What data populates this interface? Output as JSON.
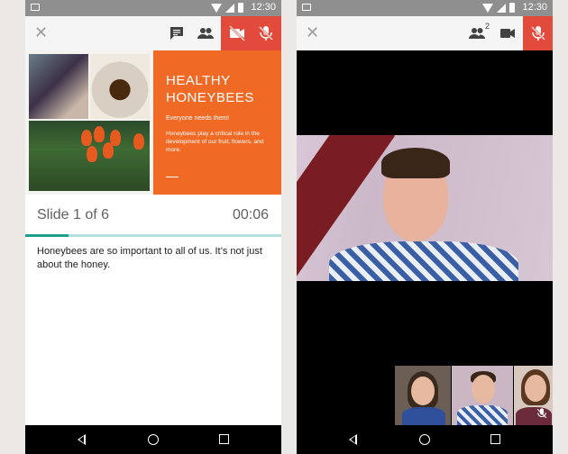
{
  "status_bar": {
    "time": "12:30"
  },
  "left_phone": {
    "slide": {
      "title_line1": "HEALTHY",
      "title_line2": "HONEYBEES",
      "subtitle": "Everyone needs them!",
      "body": "Honeybees play a critical role in the development of our fruit, flowers, and more."
    },
    "slide_counter": "Slide 1 of 6",
    "timer": "00:06",
    "progress": 0.17,
    "notes": "Honeybees are so important to all of us. It’s not just about the honey."
  },
  "right_phone": {
    "participants_badge": "2"
  },
  "colors": {
    "slide_orange": "#f06a25",
    "accent_red": "#e24b3b",
    "progress_teal": "#1e9e8c"
  },
  "icons": {
    "close": "close-icon",
    "chat": "chat-icon",
    "people": "people-icon",
    "video_off": "video-off-icon",
    "mic_off": "mic-off-icon",
    "video_camera": "videocam-icon"
  }
}
